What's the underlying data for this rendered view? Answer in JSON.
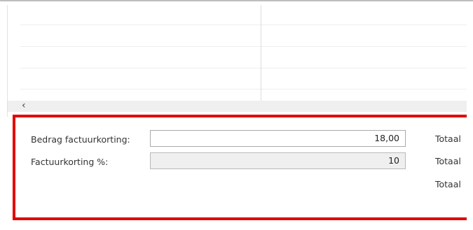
{
  "grid": {
    "scroll_left_icon": "chevron-left-icon"
  },
  "fields": {
    "invoice_discount_amount_label": "Bedrag factuurkorting:",
    "invoice_discount_amount_value": "18,00",
    "invoice_discount_percent_label": "Factuurkorting %:",
    "invoice_discount_percent_value": "10"
  },
  "totals": {
    "total_1_label": "Totaal",
    "total_2_label": "Totaal",
    "total_3_label": "Totaal"
  },
  "colors": {
    "highlight": "#e20000"
  }
}
